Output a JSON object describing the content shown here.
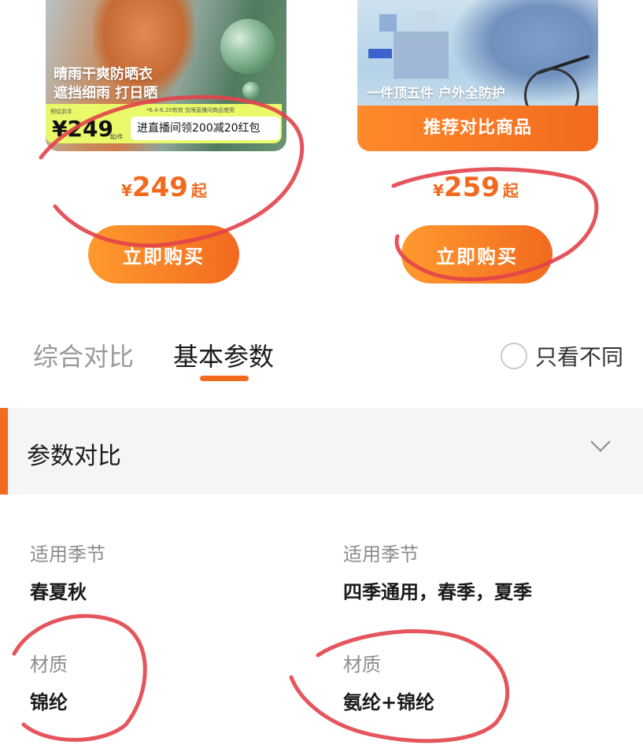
{
  "products": [
    {
      "image_text_line1": "晴雨干爽防晒衣",
      "image_text_line2": "遮挡细雨 打日晒",
      "promo_tiny_left": "预估到手",
      "promo_tiny_right": "*6.4-6.20有效 仅限直播间商品使用",
      "promo_price": "¥249",
      "promo_unit": "起/件",
      "promo_coupon": "进直播间领200减20红包",
      "price_symbol": "¥",
      "price_value": "249",
      "price_suffix": "起",
      "buy_label": "立即购买"
    },
    {
      "image_text_line": "一件顶五件 户外全防护",
      "recommend_label": "推荐对比商品",
      "price_symbol": "¥",
      "price_value": "259",
      "price_suffix": "起",
      "buy_label": "立即购买"
    }
  ],
  "tabs": [
    {
      "label": "综合对比",
      "active": false
    },
    {
      "label": "基本参数",
      "active": true
    }
  ],
  "diff_toggle": {
    "label": "只看不同",
    "checked": false
  },
  "section": {
    "title": "参数对比"
  },
  "params": {
    "left": [
      {
        "label": "适用季节",
        "value": "春夏秋"
      },
      {
        "label": "材质",
        "value": "锦纶"
      }
    ],
    "right": [
      {
        "label": "适用季节",
        "value": "四季通用，春季，夏季"
      },
      {
        "label": "材质",
        "value": "氨纶+锦纶"
      }
    ]
  },
  "colors": {
    "accent": "#f26a1f",
    "annotation": "#e2424a",
    "promo_bg": "#e9f96a"
  }
}
